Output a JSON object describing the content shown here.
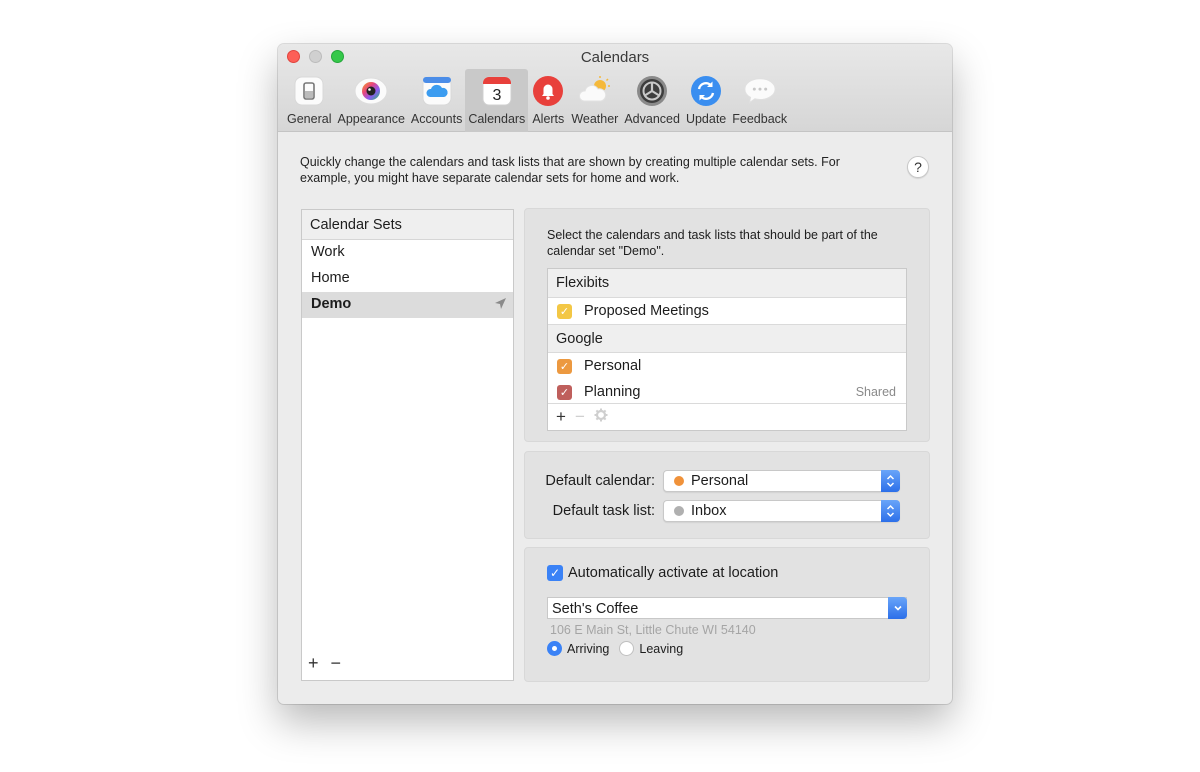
{
  "window": {
    "title": "Calendars",
    "traffic_lights": {
      "close": "#fd5f57",
      "minimize": "#d0d0d0",
      "maximize": "#35c84a"
    }
  },
  "toolbar": {
    "tabs": [
      {
        "label": "General",
        "icon": "general-icon",
        "active": false
      },
      {
        "label": "Appearance",
        "icon": "appearance-icon",
        "active": false
      },
      {
        "label": "Accounts",
        "icon": "accounts-cloud-icon",
        "active": false
      },
      {
        "label": "Calendars",
        "icon": "calendar-icon",
        "icon_text": "3",
        "active": true
      },
      {
        "label": "Alerts",
        "icon": "bell-icon",
        "active": false
      },
      {
        "label": "Weather",
        "icon": "weather-icon",
        "active": false
      },
      {
        "label": "Advanced",
        "icon": "advanced-gear-icon",
        "active": false
      },
      {
        "label": "Update",
        "icon": "update-icon",
        "active": false
      },
      {
        "label": "Feedback",
        "icon": "feedback-bubble-icon",
        "active": false
      }
    ]
  },
  "intro_text": "Quickly change the calendars and task lists that are shown by creating multiple calendar sets. For example, you might have separate calendar sets for home and work.",
  "help_label": "?",
  "calendar_sets": {
    "header": "Calendar Sets",
    "items": [
      {
        "label": "Work",
        "selected": false
      },
      {
        "label": "Home",
        "selected": false
      },
      {
        "label": "Demo",
        "selected": true,
        "has_location": true
      }
    ],
    "add_label": "+",
    "remove_label": "−"
  },
  "selection_panel": {
    "description": "Select the calendars and task lists that should be part of the calendar set \"Demo\".",
    "groups": [
      {
        "name": "Flexibits",
        "calendars": [
          {
            "label": "Proposed Meetings",
            "checked": true,
            "color": "#f3c745"
          }
        ]
      },
      {
        "name": "Google",
        "calendars": [
          {
            "label": "Personal",
            "checked": true,
            "color": "#ec9940"
          },
          {
            "label": "Planning",
            "checked": true,
            "color": "#bf5f5c",
            "badge": "Shared"
          }
        ]
      }
    ],
    "footer": {
      "add_label": "+",
      "remove_label": "−"
    }
  },
  "defaults": {
    "calendar_label": "Default calendar:",
    "calendar_value": "Personal",
    "calendar_color": "#f0923a",
    "task_list_label": "Default task list:",
    "task_list_value": "Inbox",
    "task_list_color": "#b0b0b0"
  },
  "location": {
    "auto_activate_label": "Automatically activate at location",
    "auto_activate_checked": true,
    "place": "Seth's Coffee",
    "address": "106 E Main St, Little Chute WI 54140",
    "trigger_options": [
      {
        "label": "Arriving",
        "selected": true
      },
      {
        "label": "Leaving",
        "selected": false
      }
    ]
  },
  "colors": {
    "accent": "#3a82f6"
  }
}
